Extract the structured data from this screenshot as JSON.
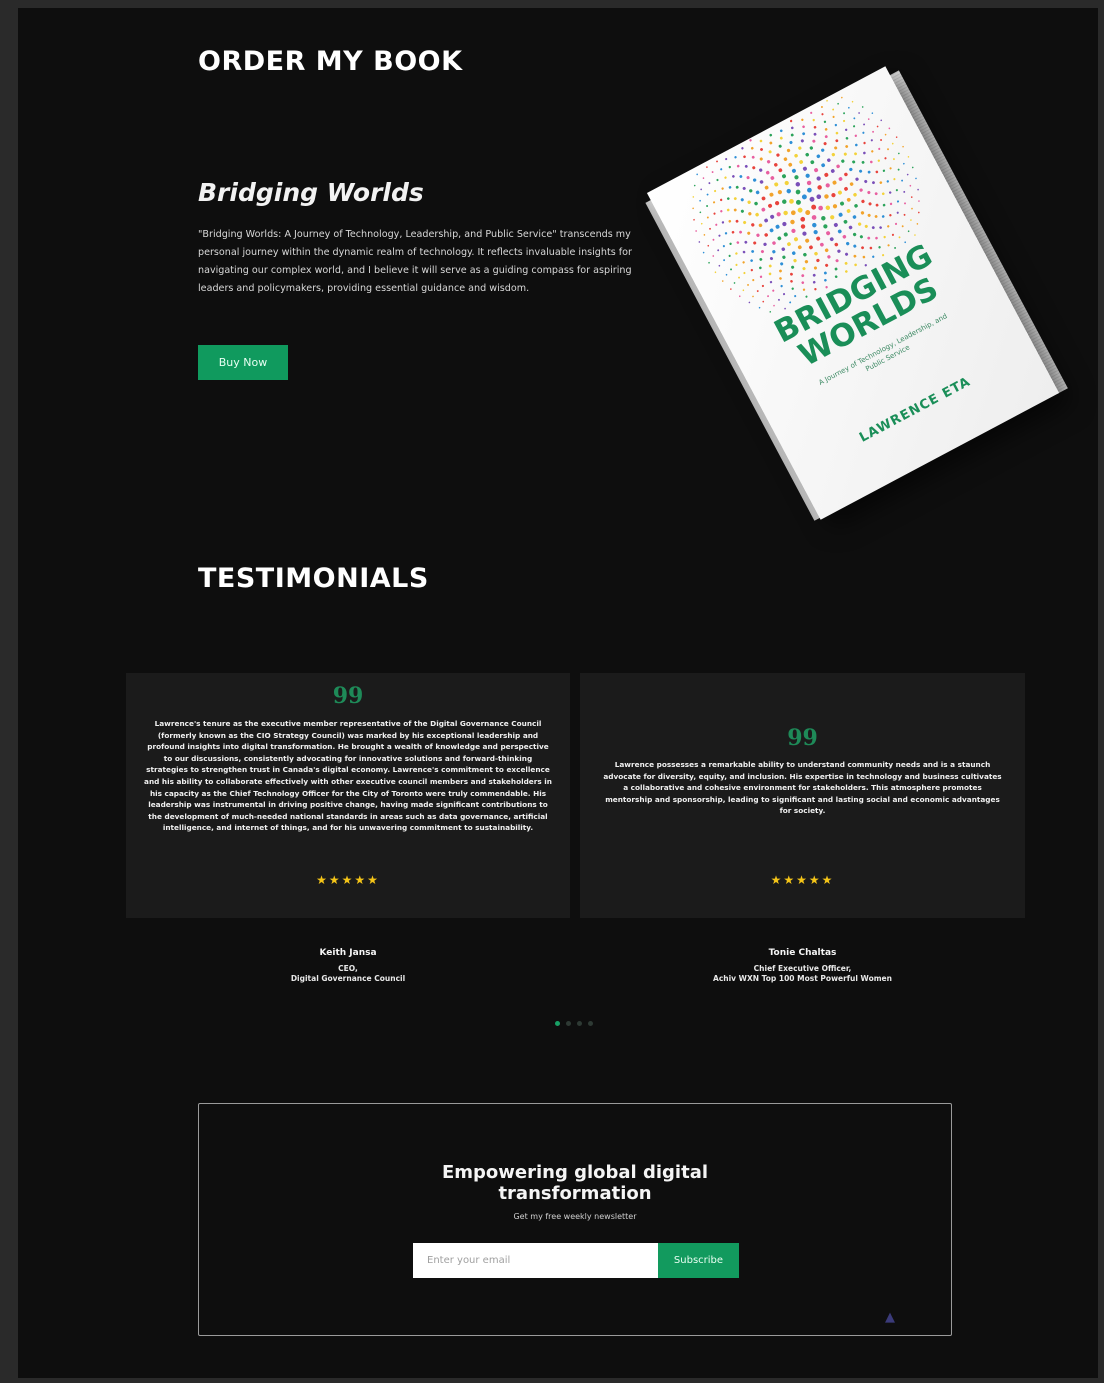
{
  "order": {
    "title": "ORDER MY BOOK",
    "book_title": "Bridging Worlds",
    "description": "\"Bridging Worlds: A Journey of Technology, Leadership, and Public Service\" transcends my personal journey within the dynamic realm of technology. It reflects invaluable insights for navigating our complex world, and I believe it will serve as a guiding compass for aspiring leaders and policymakers, providing essential guidance and wisdom.",
    "buy_label": "Buy Now"
  },
  "book_cover": {
    "title": "BRIDGING WORLDS",
    "subtitle": "A Journey of Technology, Leadership, and Public Service",
    "author": "LAWRENCE ETA"
  },
  "testimonials": {
    "title": "TESTIMONIALS",
    "quote_icon": "quote-icon",
    "items": [
      {
        "text": "Lawrence's tenure as the executive member representative of the Digital Governance Council (formerly known as the CIO Strategy Council) was marked by his exceptional leadership and profound insights into digital transformation. He brought a wealth of knowledge and perspective to our discussions, consistently advocating for innovative solutions and forward-thinking strategies to strengthen trust in Canada's digital economy. Lawrence's commitment to excellence and his ability to collaborate effectively with other executive council members and stakeholders in his capacity as the Chief Technology Officer for the City of Toronto were truly commendable. His leadership was instrumental in driving positive change, having made significant contributions to the development of much-needed national standards in areas such as data governance, artificial intelligence, and internet of things, and for his unwavering commitment to sustainability.",
        "stars": "★★★★★",
        "name": "Keith Jansa",
        "role_line1": "CEO,",
        "role_line2": "Digital Governance Council"
      },
      {
        "text": "Lawrence possesses a remarkable ability to understand community needs and is a staunch advocate for diversity, equity, and inclusion. His expertise in technology and business cultivates a collaborative and cohesive environment for stakeholders. This atmosphere promotes mentorship and sponsorship, leading to significant and lasting social and economic advantages for society.",
        "stars": "★★★★★",
        "name": "Tonie Chaltas",
        "role_line1": "Chief Executive Officer,",
        "role_line2": "Achiv WXN Top 100 Most Powerful Women"
      }
    ]
  },
  "newsletter": {
    "title_line1": "Empowering global digital",
    "title_line2": "transformation",
    "subtitle": "Get my free weekly newsletter",
    "email_placeholder": "Enter your email",
    "subscribe_label": "Subscribe"
  },
  "colors": {
    "accent": "#129a5e",
    "background": "#0e0e0e",
    "card": "#1b1b1b",
    "star": "#f5c518"
  }
}
